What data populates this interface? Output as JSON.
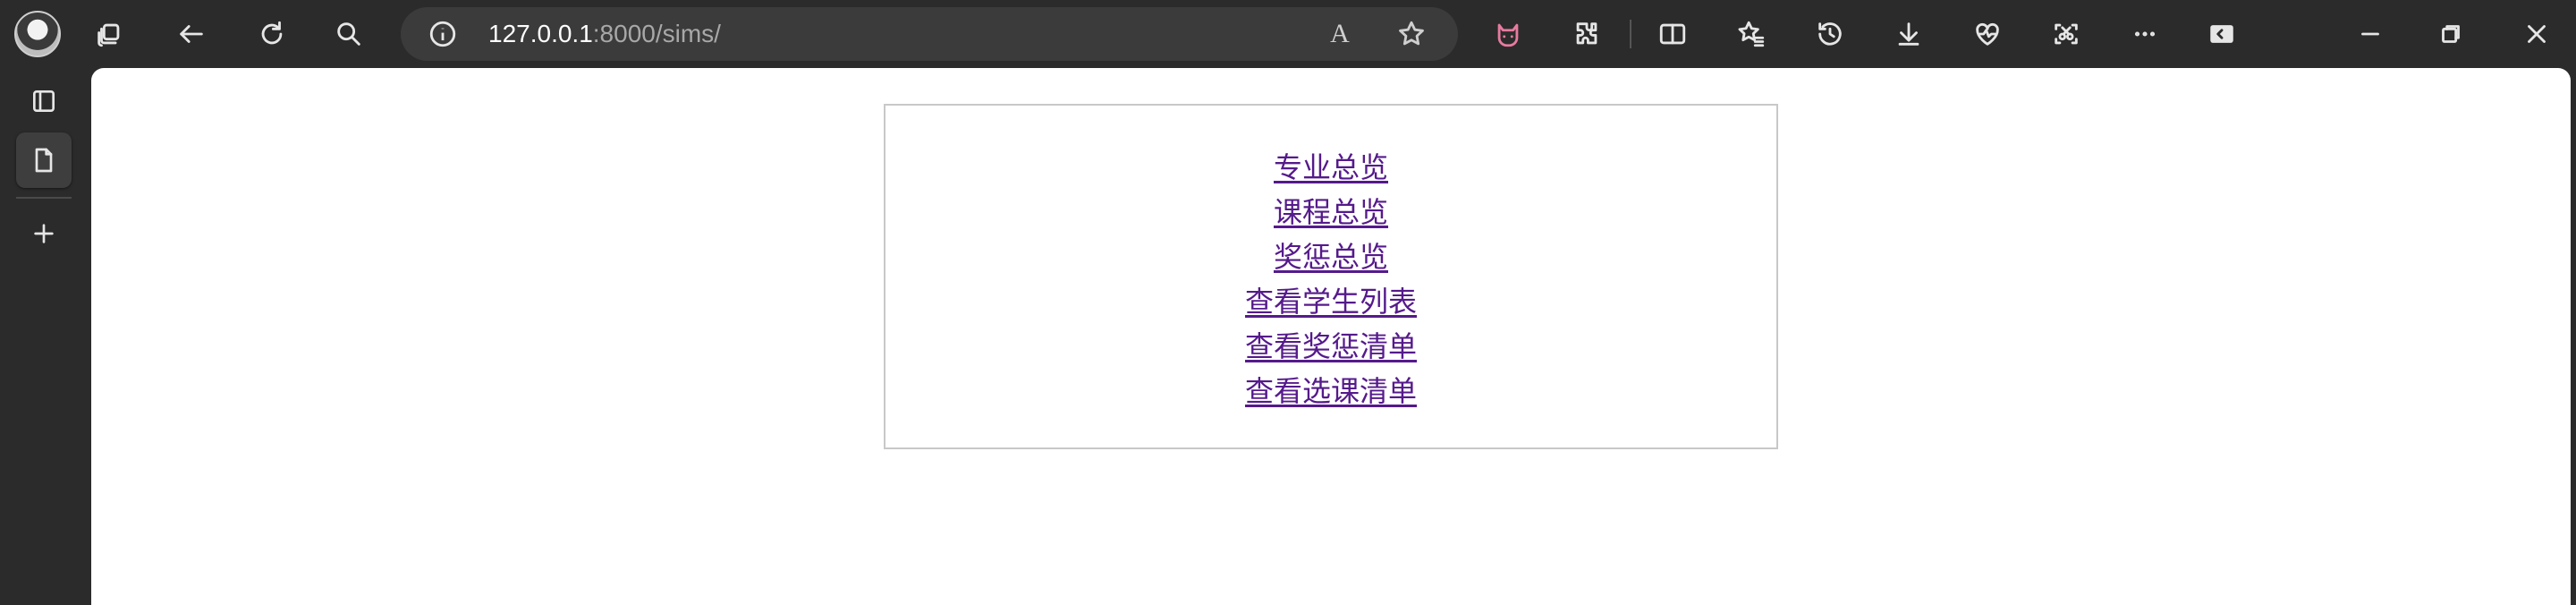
{
  "browser": {
    "address": {
      "host": "127.0.0.1",
      "rest": ":8000/sims/"
    },
    "read_aloud_label": "A",
    "colors": {
      "chrome_bg": "#2b2b2b",
      "address_bg": "#3b3b3b",
      "page_bg": "#ffffff",
      "visited_link": "#551a8b",
      "copilot_accent": "#e87aa0"
    },
    "toolbar_icons": [
      "profile-avatar",
      "workspaces-icon",
      "back-icon",
      "refresh-icon",
      "search-icon",
      "site-info-icon",
      "read-aloud-icon",
      "favorite-star-icon",
      "cat-extension-icon",
      "extensions-icon",
      "split-screen-icon",
      "favorites-icon",
      "history-icon",
      "downloads-icon",
      "browser-essentials-icon",
      "screenshot-icon",
      "more-icon",
      "sidebar-icon",
      "minimize-icon",
      "restore-icon",
      "close-icon"
    ],
    "rail_icons": [
      "tab-actions-icon",
      "page-tab-icon",
      "new-tab-icon"
    ]
  },
  "page": {
    "links": [
      "专业总览",
      "课程总览",
      "奖惩总览",
      "查看学生列表",
      "查看奖惩清单",
      "查看选课清单"
    ]
  }
}
